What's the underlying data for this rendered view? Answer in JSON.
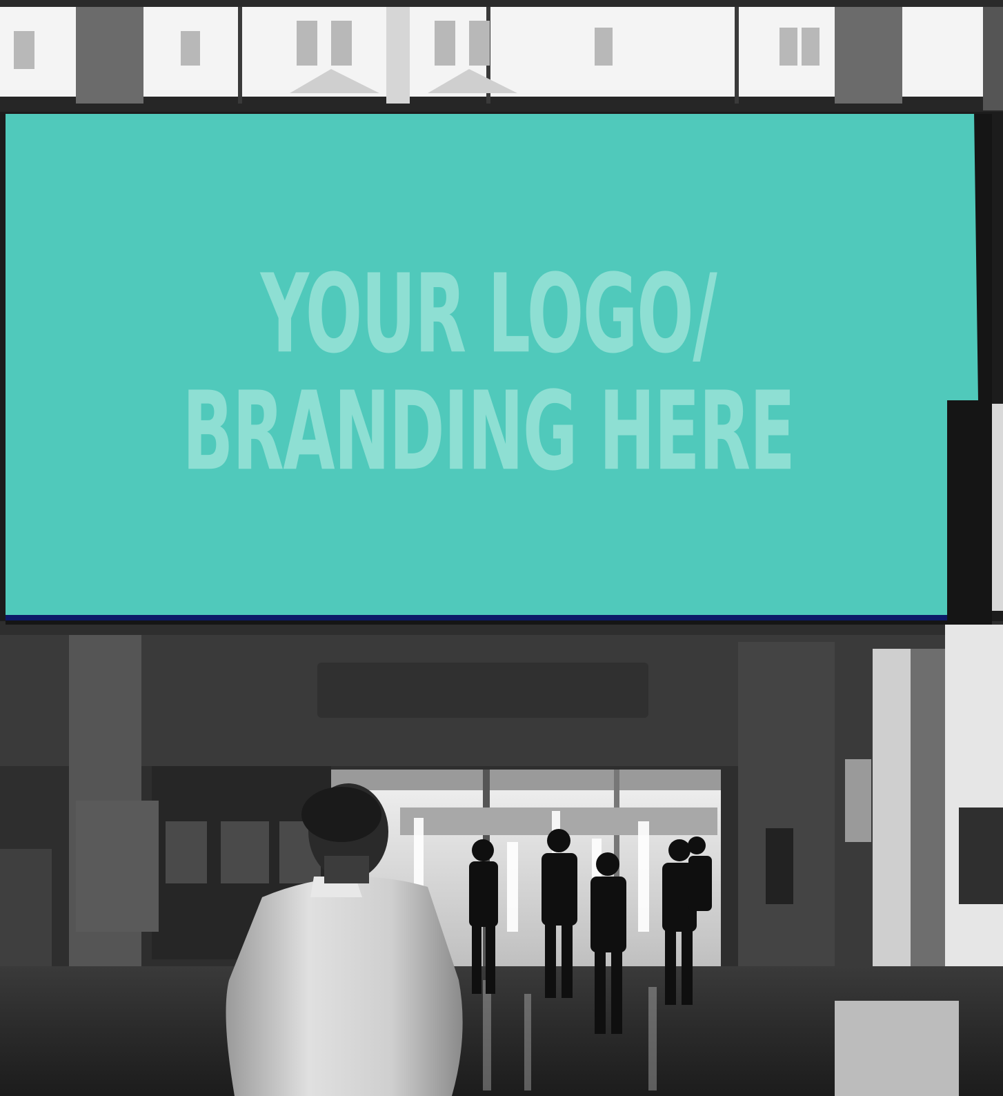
{
  "billboard": {
    "line1": "YOUR LOGO/",
    "line2": "BRANDING HERE",
    "panel_color": "#50c9bb",
    "text_color": "#8edfd3",
    "frame_color": "#151515",
    "edge_color": "#0d1a66"
  },
  "scene": {
    "style": "black-and-white photo",
    "subject": "exhibition hall entrance"
  }
}
